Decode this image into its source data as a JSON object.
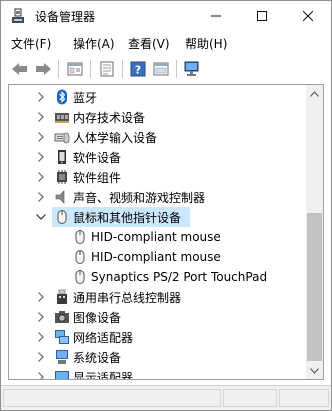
{
  "window": {
    "title": "设备管理器"
  },
  "menu": [
    "文件(F)",
    "操作(A)",
    "查看(V)",
    "帮助(H)"
  ],
  "toolbar": {
    "buttons": [
      "back-icon",
      "forward-icon",
      "properties-icon",
      "show-hidden-icon",
      "help-icon",
      "update-driver-icon",
      "scan-hardware-icon"
    ]
  },
  "tree": [
    {
      "label": "蓝牙",
      "icon": "bluetooth-icon",
      "expanded": false
    },
    {
      "label": "内存技术设备",
      "icon": "memory-device-icon",
      "expanded": false
    },
    {
      "label": "人体学输入设备",
      "icon": "hid-icon",
      "expanded": false
    },
    {
      "label": "软件设备",
      "icon": "software-device-icon",
      "expanded": false
    },
    {
      "label": "软件组件",
      "icon": "software-component-icon",
      "expanded": false
    },
    {
      "label": "声音、视频和游戏控制器",
      "icon": "speaker-icon",
      "expanded": false
    },
    {
      "label": "鼠标和其他指针设备",
      "icon": "mouse-icon",
      "expanded": true,
      "selected": true
    },
    {
      "label": "HID-compliant mouse",
      "icon": "mouse-icon",
      "child": true
    },
    {
      "label": "HID-compliant mouse",
      "icon": "mouse-icon",
      "child": true
    },
    {
      "label": "Synaptics PS/2 Port TouchPad",
      "icon": "mouse-icon",
      "child": true
    },
    {
      "label": "通用串行总线控制器",
      "icon": "usb-icon",
      "expanded": false
    },
    {
      "label": "图像设备",
      "icon": "camera-icon",
      "expanded": false
    },
    {
      "label": "网络适配器",
      "icon": "network-icon",
      "expanded": false
    },
    {
      "label": "系统设备",
      "icon": "system-device-icon",
      "expanded": false
    },
    {
      "label": "显示适配器",
      "icon": "display-adapter-icon",
      "expanded": false
    }
  ]
}
